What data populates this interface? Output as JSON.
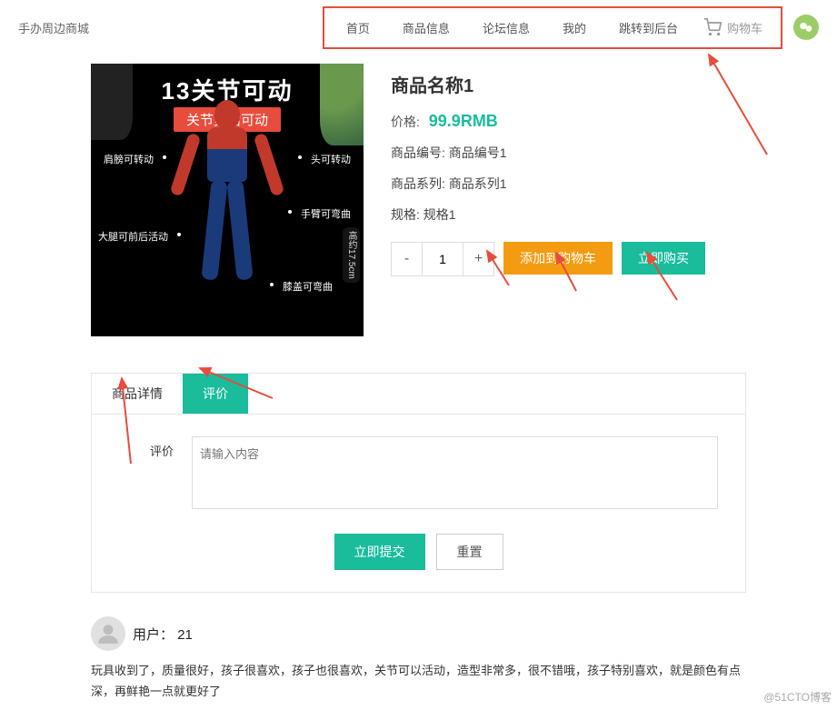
{
  "site_title": "手办周边商城",
  "nav": {
    "items": [
      "首页",
      "商品信息",
      "论坛信息",
      "我的",
      "跳转到后台"
    ],
    "cart_label": "购物车"
  },
  "product": {
    "name": "商品名称1",
    "price_label": "价格:",
    "price_value": "99.9RMB",
    "code_label": "商品编号:",
    "code_value": "商品编号1",
    "series_label": "商品系列:",
    "series_value": "商品系列1",
    "spec_label": "规格:",
    "spec_value": "规格1",
    "qty": "1",
    "add_cart": "添加到购物车",
    "buy_now": "立即购买",
    "image": {
      "headline": "13关节可动",
      "sub": "关节灵活可动",
      "cap1": "肩膀可转动",
      "cap2": "头可转动",
      "cap3": "手臂可弯曲",
      "cap4": "大腿可前后活动",
      "cap5": "膝盖可弯曲",
      "height": "高约17.5cm"
    }
  },
  "tabs": {
    "detail": "商品详情",
    "review": "评价"
  },
  "review_form": {
    "label": "评价",
    "placeholder": "请输入内容",
    "submit": "立即提交",
    "reset": "重置"
  },
  "reviews": [
    {
      "user_label": "用户：",
      "user_id": "21",
      "text": "玩具收到了，质量很好，孩子很喜欢，孩子也很喜欢，关节可以活动，造型非常多，很不错哦，孩子特别喜欢，就是颜色有点深，再鲜艳一点就更好了"
    }
  ],
  "watermark": "@51CTO博客"
}
